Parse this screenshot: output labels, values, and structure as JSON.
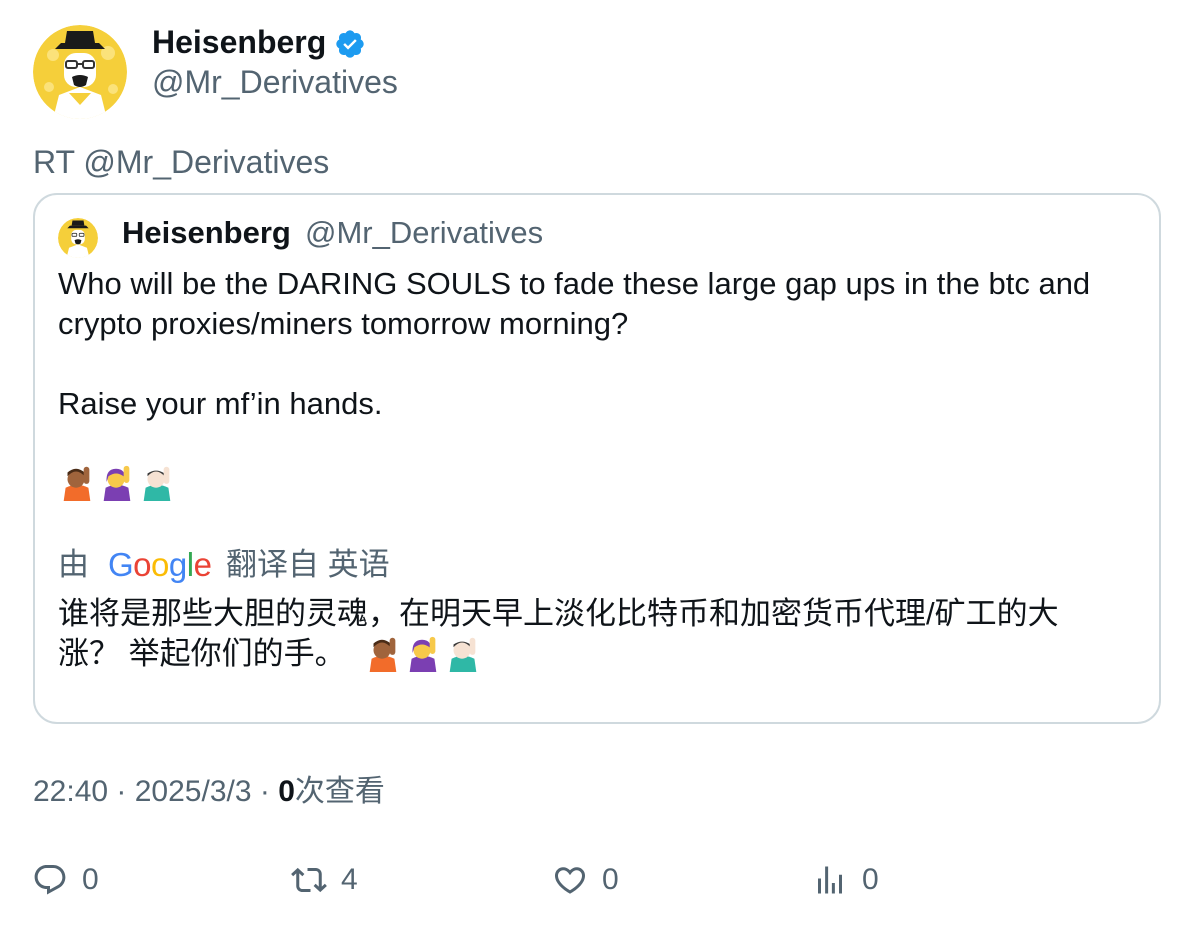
{
  "author": {
    "name": "Heisenberg",
    "handle": "@Mr_Derivatives"
  },
  "retweet_label": "RT @Mr_Derivatives",
  "quote": {
    "name": "Heisenberg",
    "handle": "@Mr_Derivatives",
    "text_line1": "Who will be the DARING SOULS to fade these large gap ups in the btc and",
    "text_line2": "crypto proxies/miners tomorrow morning?",
    "text_line3": "Raise your mf’in hands.",
    "translate_by": "由",
    "translate_from": "翻译自 英语",
    "google_letters": [
      "G",
      "o",
      "o",
      "g",
      "l",
      "e"
    ],
    "cn_line1": "谁将是那些大胆的灵魂，在明天早上淡化比特币和加密货币代理/矿工的大",
    "cn_line2": "涨？ 举起你们的手。"
  },
  "meta": {
    "time": "22:40",
    "sep1": " · ",
    "date": "2025/3/3",
    "sep2": " · ",
    "views_count": "0",
    "views_label": "次查看"
  },
  "actions": {
    "reply": "0",
    "retweet": "4",
    "like": "0",
    "views": "0"
  },
  "colors": {
    "text": "#0f1419",
    "secondary": "#536471",
    "border": "#cfd9de",
    "verified": "#1d9bf0"
  }
}
